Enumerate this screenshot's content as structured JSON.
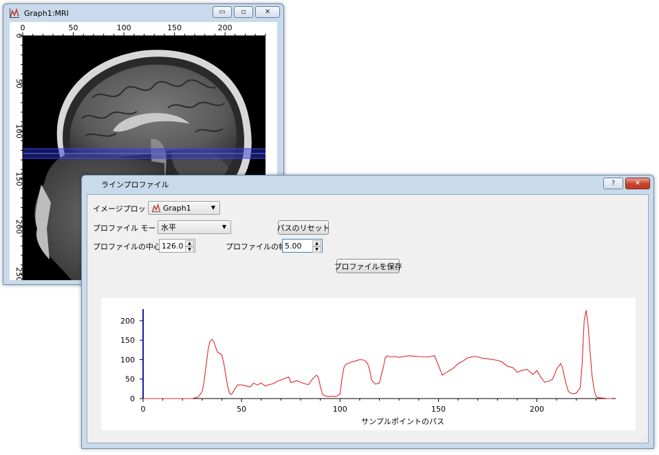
{
  "graph_window": {
    "title": "Graph1:MRI",
    "controls": {
      "minimize": "▭",
      "maximize": "▫",
      "close": "✕"
    },
    "top_axis_ticks": [
      0,
      50,
      100,
      150,
      200
    ],
    "left_axis_ticks": [
      0,
      50,
      100,
      150,
      200,
      250
    ],
    "profile_band": {
      "center": 126.0,
      "width": 5.0
    }
  },
  "dialog": {
    "title": "ラインプロファイル",
    "controls": {
      "help": "?",
      "close": "✕"
    },
    "image_plot_label": "イメージプロット:",
    "image_plot_value": "Graph1",
    "profile_mode_label": "プロファイル モード:",
    "profile_mode_value": "水平",
    "reset_path_button": "パスのリセット",
    "profile_center_label": "プロファイルの中心:",
    "profile_center_value": "126.0",
    "profile_width_label": "プロファイルの幅:",
    "profile_width_value": "5.00",
    "save_profile_button": "プロファイルを保存"
  },
  "chart_data": {
    "type": "line",
    "xlabel": "サンプルポイントのパス",
    "ylabel": "",
    "xlim": [
      0,
      240
    ],
    "ylim": [
      0,
      230
    ],
    "x_ticks": [
      0,
      50,
      100,
      150,
      200
    ],
    "y_ticks": [
      0,
      50,
      100,
      150,
      200
    ],
    "grid": false,
    "color": "#e0242a",
    "series": [
      {
        "x": [
          0,
          10,
          20,
          25,
          28,
          30,
          31,
          32,
          33,
          34,
          35,
          36,
          37,
          38,
          39,
          40,
          41,
          42,
          43,
          44,
          45,
          46,
          48,
          50,
          52,
          54,
          55,
          56,
          58,
          60,
          62,
          64,
          66,
          68,
          70,
          72,
          74,
          75,
          76,
          78,
          80,
          82,
          84,
          86,
          88,
          89,
          90,
          91,
          92,
          94,
          96,
          98,
          100,
          101,
          102,
          103,
          104,
          106,
          108,
          110,
          112,
          113,
          114,
          115,
          116,
          118,
          120,
          122,
          123,
          124,
          125,
          126,
          128,
          130,
          135,
          140,
          145,
          148,
          150,
          152,
          155,
          158,
          160,
          162,
          165,
          168,
          170,
          172,
          175,
          178,
          180,
          182,
          185,
          188,
          190,
          192,
          195,
          198,
          200,
          202,
          204,
          206,
          208,
          210,
          212,
          213,
          214,
          215,
          216,
          218,
          220,
          222,
          223,
          224,
          225,
          226,
          227,
          228,
          229,
          230,
          231,
          232,
          234,
          236,
          238
        ],
        "y": [
          0,
          0,
          0,
          0,
          4,
          18,
          45,
          85,
          125,
          148,
          152,
          145,
          130,
          118,
          116,
          112,
          90,
          60,
          30,
          13,
          11,
          20,
          35,
          35,
          33,
          30,
          32,
          40,
          35,
          40,
          32,
          36,
          38,
          44,
          48,
          52,
          55,
          42,
          42,
          46,
          42,
          38,
          36,
          50,
          60,
          55,
          32,
          12,
          8,
          5,
          6,
          5,
          12,
          50,
          80,
          88,
          90,
          94,
          97,
          100,
          99,
          96,
          90,
          75,
          48,
          37,
          40,
          80,
          105,
          110,
          108,
          107,
          108,
          106,
          110,
          108,
          107,
          110,
          85,
          60,
          70,
          80,
          90,
          95,
          105,
          108,
          107,
          104,
          102,
          100,
          98,
          95,
          83,
          79,
          67,
          72,
          75,
          62,
          72,
          55,
          42,
          45,
          50,
          75,
          90,
          80,
          55,
          35,
          18,
          12,
          14,
          28,
          90,
          200,
          227,
          190,
          120,
          60,
          25,
          6,
          2,
          2,
          1,
          0,
          0
        ]
      }
    ]
  }
}
